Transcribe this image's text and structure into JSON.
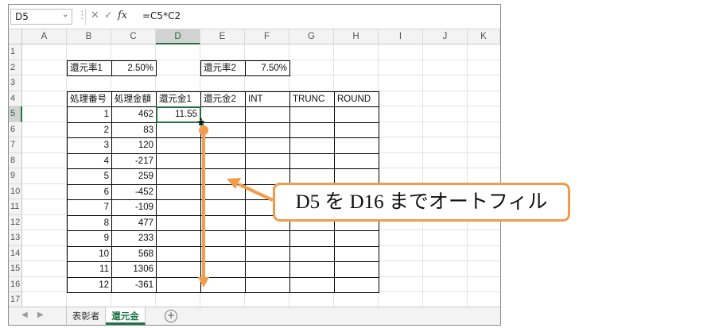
{
  "formula_bar": {
    "name_box": "D5",
    "name_box_arrow": "⌄",
    "cancel_icon": "✕",
    "enter_icon": "✓",
    "fx_label": "fx",
    "formula": "=C5*C2"
  },
  "columns": [
    "A",
    "B",
    "C",
    "D",
    "E",
    "F",
    "G",
    "H",
    "I",
    "J",
    "K"
  ],
  "rows": [
    "1",
    "2",
    "3",
    "4",
    "5",
    "6",
    "7",
    "8",
    "9",
    "10",
    "11",
    "12",
    "13",
    "14",
    "15",
    "16",
    "17"
  ],
  "selected_cell": {
    "column": "D",
    "row": "5"
  },
  "cells": {
    "B2": "還元率1",
    "C2": "2.50%",
    "E2": "還元率2",
    "F2": "7.50%",
    "B4": "処理番号",
    "C4": "処理金額",
    "D4": "還元金1",
    "E4": "還元金2",
    "F4": "INT",
    "G4": "TRUNC",
    "H4": "ROUND",
    "B5": "1",
    "C5": "462",
    "D5": "11.55",
    "B6": "2",
    "C6": "83",
    "B7": "3",
    "C7": "120",
    "B8": "4",
    "C8": "-217",
    "B9": "5",
    "C9": "259",
    "B10": "6",
    "C10": "-452",
    "B11": "7",
    "C11": "-109",
    "B12": "8",
    "C12": "477",
    "B13": "9",
    "C13": "233",
    "B14": "10",
    "C14": "568",
    "B15": "11",
    "C15": "1306",
    "B16": "12",
    "C16": "-361"
  },
  "sheet_tabs": {
    "prev_icon": "◀",
    "next_icon": "▶",
    "tabs": [
      {
        "label": "表彰者",
        "active": false
      },
      {
        "label": "還元金",
        "active": true
      }
    ],
    "add_icon": "+"
  },
  "annotation": {
    "text": "D5 を D16 までオートフィル",
    "color": "#f29b4b"
  },
  "colors": {
    "excel_green": "#217346",
    "header_bg": "#f3f3f3",
    "gridline": "#e2e2e2"
  }
}
